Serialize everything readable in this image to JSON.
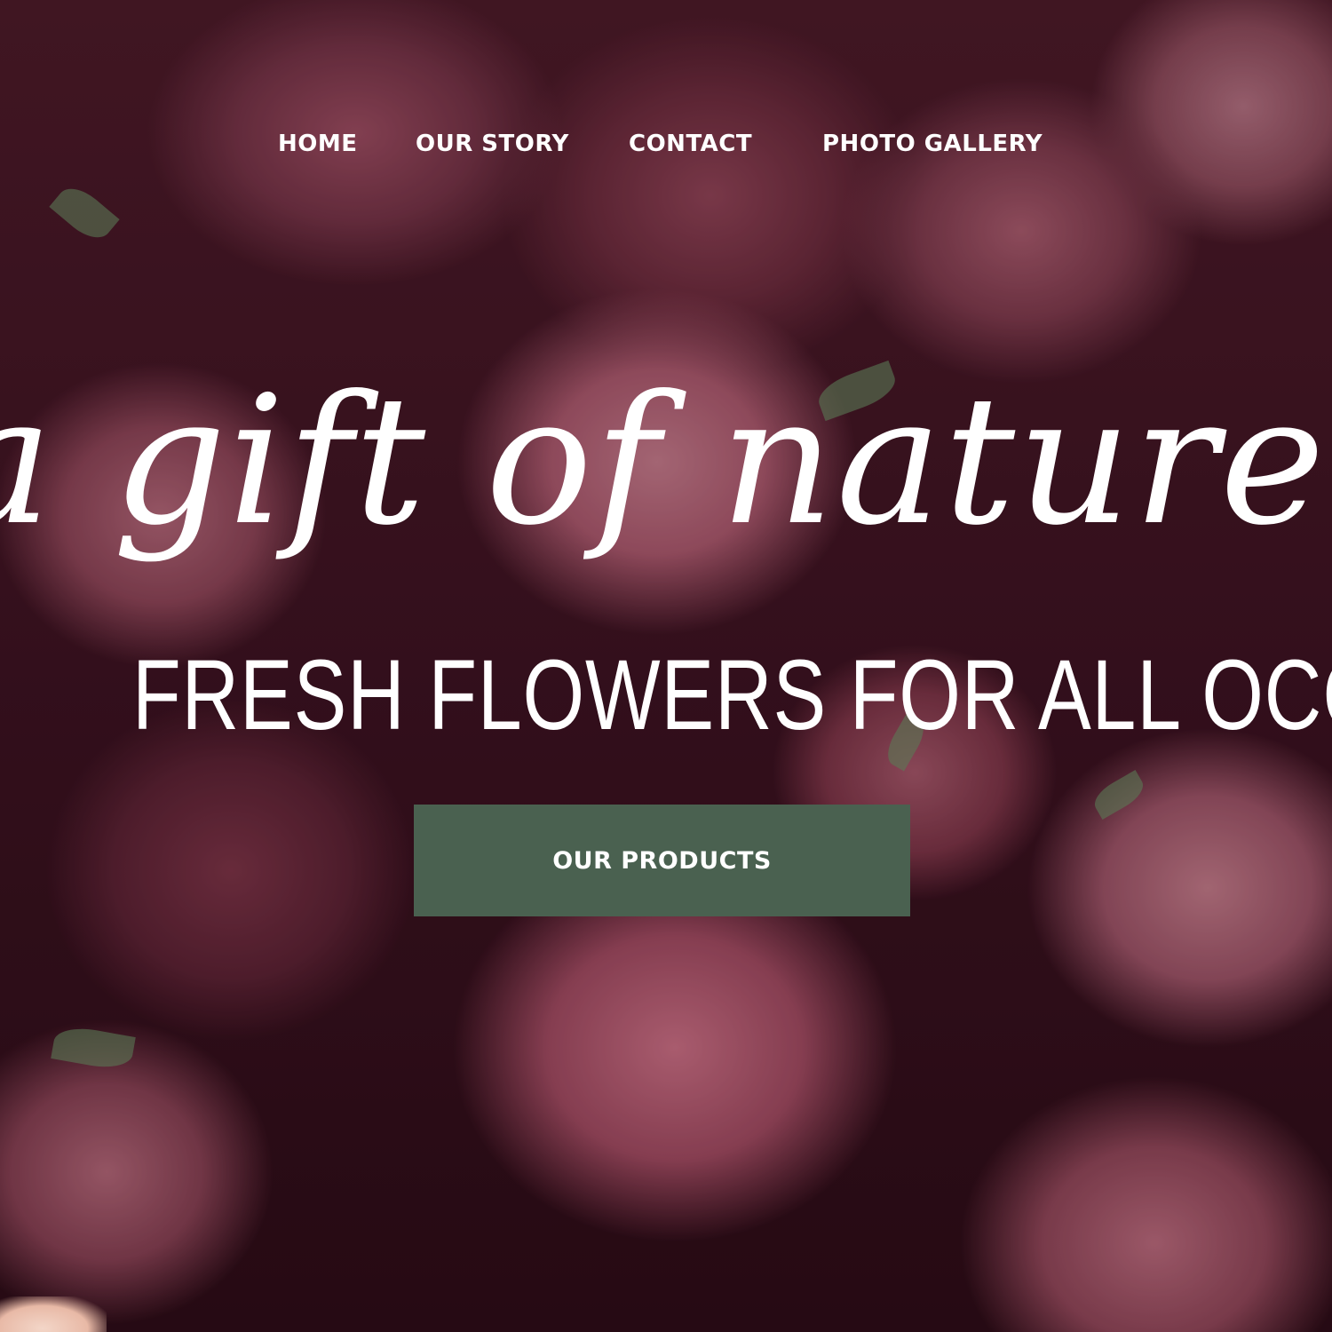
{
  "nav": {
    "items": [
      {
        "label": "HOME"
      },
      {
        "label": "OUR STORY"
      },
      {
        "label": "CONTACT"
      },
      {
        "label": "PHOTO GALLERY"
      }
    ]
  },
  "hero": {
    "tagline": "a gift of nature in bloom",
    "headline": "FRESH FLOWERS FOR ALL OCCASIONS",
    "cta_label": "OUR PRODUCTS"
  },
  "colors": {
    "cta_background": "#4a6150",
    "text": "#ffffff",
    "rose_pink": "#c27a8a"
  }
}
